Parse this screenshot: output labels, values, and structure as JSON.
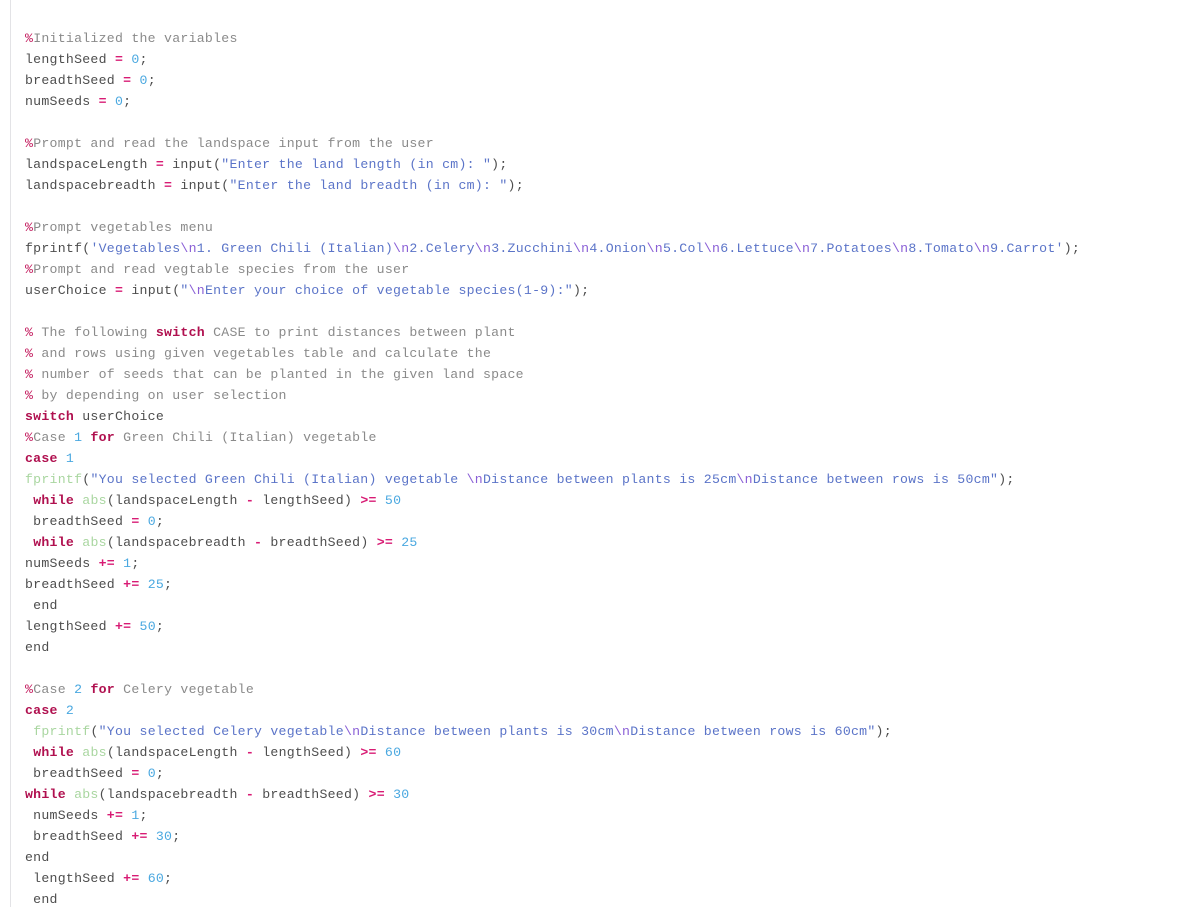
{
  "editor": {
    "language": "MATLAB",
    "background_color": "#ffffff",
    "gutter_rule_color": "#e3e3e6"
  },
  "palette": {
    "plain": "#4d4d4d",
    "comment": "#8a8a8a",
    "percent_marker": "#c2185b",
    "keyword": "#b0104f",
    "number": "#4aa8e0",
    "operator": "#d81b74",
    "string": "#5b74c8",
    "escape": "#8a5fd6",
    "function": "#a9d6a0"
  },
  "code": {
    "lines": [
      {
        "id": 1,
        "tokens": [
          {
            "t": "%",
            "c": "pct"
          },
          {
            "t": "Initialized the variables",
            "c": "comment"
          }
        ]
      },
      {
        "id": 2,
        "tokens": [
          {
            "t": "lengthSeed ",
            "c": "plain"
          },
          {
            "t": "=",
            "c": "operator"
          },
          {
            "t": " ",
            "c": "plain"
          },
          {
            "t": "0",
            "c": "number"
          },
          {
            "t": ";",
            "c": "plain"
          }
        ]
      },
      {
        "id": 3,
        "tokens": [
          {
            "t": "breadthSeed ",
            "c": "plain"
          },
          {
            "t": "=",
            "c": "operator"
          },
          {
            "t": " ",
            "c": "plain"
          },
          {
            "t": "0",
            "c": "number"
          },
          {
            "t": ";",
            "c": "plain"
          }
        ]
      },
      {
        "id": 4,
        "tokens": [
          {
            "t": "numSeeds ",
            "c": "plain"
          },
          {
            "t": "=",
            "c": "operator"
          },
          {
            "t": " ",
            "c": "plain"
          },
          {
            "t": "0",
            "c": "number"
          },
          {
            "t": ";",
            "c": "plain"
          }
        ]
      },
      {
        "id": 5,
        "tokens": []
      },
      {
        "id": 6,
        "tokens": [
          {
            "t": "%",
            "c": "pct"
          },
          {
            "t": "Prompt and read the landspace input from the user",
            "c": "comment"
          }
        ]
      },
      {
        "id": 7,
        "tokens": [
          {
            "t": "landspaceLength ",
            "c": "plain"
          },
          {
            "t": "=",
            "c": "operator"
          },
          {
            "t": " input(",
            "c": "plain"
          },
          {
            "t": "\"Enter the land length (in cm): \"",
            "c": "string"
          },
          {
            "t": ");",
            "c": "plain"
          }
        ]
      },
      {
        "id": 8,
        "tokens": [
          {
            "t": "landspacebreadth ",
            "c": "plain"
          },
          {
            "t": "=",
            "c": "operator"
          },
          {
            "t": " input(",
            "c": "plain"
          },
          {
            "t": "\"Enter the land breadth (in cm): \"",
            "c": "string"
          },
          {
            "t": ");",
            "c": "plain"
          }
        ]
      },
      {
        "id": 9,
        "tokens": []
      },
      {
        "id": 10,
        "tokens": [
          {
            "t": "%",
            "c": "pct"
          },
          {
            "t": "Prompt vegetables menu",
            "c": "comment"
          }
        ]
      },
      {
        "id": 11,
        "tokens": [
          {
            "t": "fprintf(",
            "c": "plain"
          },
          {
            "t": "'Vegetables",
            "c": "string"
          },
          {
            "t": "\\n",
            "c": "escape"
          },
          {
            "t": "1. Green Chili (Italian)",
            "c": "string"
          },
          {
            "t": "\\n",
            "c": "escape"
          },
          {
            "t": "2.Celery",
            "c": "string"
          },
          {
            "t": "\\n",
            "c": "escape"
          },
          {
            "t": "3.Zucchini",
            "c": "string"
          },
          {
            "t": "\\n",
            "c": "escape"
          },
          {
            "t": "4.Onion",
            "c": "string"
          },
          {
            "t": "\\n",
            "c": "escape"
          },
          {
            "t": "5.Col",
            "c": "string"
          },
          {
            "t": "\\n",
            "c": "escape"
          },
          {
            "t": "6.Lettuce",
            "c": "string"
          },
          {
            "t": "\\n",
            "c": "escape"
          },
          {
            "t": "7.Potatoes",
            "c": "string"
          },
          {
            "t": "\\n",
            "c": "escape"
          },
          {
            "t": "8.Tomato",
            "c": "string"
          },
          {
            "t": "\\n",
            "c": "escape"
          },
          {
            "t": "9.Carrot'",
            "c": "string"
          },
          {
            "t": ");",
            "c": "plain"
          }
        ]
      },
      {
        "id": 12,
        "tokens": [
          {
            "t": "%",
            "c": "pct"
          },
          {
            "t": "Prompt and read vegtable species from the user",
            "c": "comment"
          }
        ]
      },
      {
        "id": 13,
        "tokens": [
          {
            "t": "userChoice ",
            "c": "plain"
          },
          {
            "t": "=",
            "c": "operator"
          },
          {
            "t": " input(",
            "c": "plain"
          },
          {
            "t": "\"",
            "c": "string"
          },
          {
            "t": "\\n",
            "c": "escape"
          },
          {
            "t": "Enter your choice of vegetable species(1-9):\"",
            "c": "string"
          },
          {
            "t": ");",
            "c": "plain"
          }
        ]
      },
      {
        "id": 14,
        "tokens": []
      },
      {
        "id": 15,
        "tokens": [
          {
            "t": "%",
            "c": "pct"
          },
          {
            "t": " The following ",
            "c": "comment"
          },
          {
            "t": "switch",
            "c": "keyword"
          },
          {
            "t": " CASE to print distances between plant",
            "c": "comment"
          }
        ]
      },
      {
        "id": 16,
        "tokens": [
          {
            "t": "%",
            "c": "pct"
          },
          {
            "t": " and rows using given vegetables table and calculate the",
            "c": "comment"
          }
        ]
      },
      {
        "id": 17,
        "tokens": [
          {
            "t": "%",
            "c": "pct"
          },
          {
            "t": " number of seeds that can be planted in the given land space",
            "c": "comment"
          }
        ]
      },
      {
        "id": 18,
        "tokens": [
          {
            "t": "%",
            "c": "pct"
          },
          {
            "t": " by depending on user selection",
            "c": "comment"
          }
        ]
      },
      {
        "id": 19,
        "tokens": [
          {
            "t": "switch",
            "c": "keyword"
          },
          {
            "t": " userChoice",
            "c": "plain"
          }
        ]
      },
      {
        "id": 20,
        "tokens": [
          {
            "t": "%",
            "c": "pct"
          },
          {
            "t": "Case ",
            "c": "comment"
          },
          {
            "t": "1",
            "c": "number"
          },
          {
            "t": " ",
            "c": "comment"
          },
          {
            "t": "for",
            "c": "keyword"
          },
          {
            "t": " Green Chili (Italian) vegetable",
            "c": "comment"
          }
        ]
      },
      {
        "id": 21,
        "tokens": [
          {
            "t": "case",
            "c": "keyword"
          },
          {
            "t": " ",
            "c": "plain"
          },
          {
            "t": "1",
            "c": "number"
          }
        ]
      },
      {
        "id": 22,
        "tokens": [
          {
            "t": "fprintf",
            "c": "func"
          },
          {
            "t": "(",
            "c": "plain"
          },
          {
            "t": "\"You selected Green Chili (Italian) vegetable ",
            "c": "string"
          },
          {
            "t": "\\n",
            "c": "escape"
          },
          {
            "t": "Distance between plants is 25cm",
            "c": "string"
          },
          {
            "t": "\\n",
            "c": "escape"
          },
          {
            "t": "Distance between rows is 50cm\"",
            "c": "string"
          },
          {
            "t": ");",
            "c": "plain"
          }
        ]
      },
      {
        "id": 23,
        "tokens": [
          {
            "t": " ",
            "c": "plain"
          },
          {
            "t": "while",
            "c": "keyword"
          },
          {
            "t": " ",
            "c": "plain"
          },
          {
            "t": "abs",
            "c": "func"
          },
          {
            "t": "(landspaceLength ",
            "c": "plain"
          },
          {
            "t": "-",
            "c": "operator"
          },
          {
            "t": " lengthSeed) ",
            "c": "plain"
          },
          {
            "t": ">=",
            "c": "operator"
          },
          {
            "t": " ",
            "c": "plain"
          },
          {
            "t": "50",
            "c": "number"
          }
        ]
      },
      {
        "id": 24,
        "tokens": [
          {
            "t": " breadthSeed ",
            "c": "plain"
          },
          {
            "t": "=",
            "c": "operator"
          },
          {
            "t": " ",
            "c": "plain"
          },
          {
            "t": "0",
            "c": "number"
          },
          {
            "t": ";",
            "c": "plain"
          }
        ]
      },
      {
        "id": 25,
        "tokens": [
          {
            "t": " ",
            "c": "plain"
          },
          {
            "t": "while",
            "c": "keyword"
          },
          {
            "t": " ",
            "c": "plain"
          },
          {
            "t": "abs",
            "c": "func"
          },
          {
            "t": "(landspacebreadth ",
            "c": "plain"
          },
          {
            "t": "-",
            "c": "operator"
          },
          {
            "t": " breadthSeed) ",
            "c": "plain"
          },
          {
            "t": ">=",
            "c": "operator"
          },
          {
            "t": " ",
            "c": "plain"
          },
          {
            "t": "25",
            "c": "number"
          }
        ]
      },
      {
        "id": 26,
        "tokens": [
          {
            "t": "numSeeds ",
            "c": "plain"
          },
          {
            "t": "+=",
            "c": "operator"
          },
          {
            "t": " ",
            "c": "plain"
          },
          {
            "t": "1",
            "c": "number"
          },
          {
            "t": ";",
            "c": "plain"
          }
        ]
      },
      {
        "id": 27,
        "tokens": [
          {
            "t": "breadthSeed ",
            "c": "plain"
          },
          {
            "t": "+=",
            "c": "operator"
          },
          {
            "t": " ",
            "c": "plain"
          },
          {
            "t": "25",
            "c": "number"
          },
          {
            "t": ";",
            "c": "plain"
          }
        ]
      },
      {
        "id": 28,
        "tokens": [
          {
            "t": " end",
            "c": "plain"
          }
        ]
      },
      {
        "id": 29,
        "tokens": [
          {
            "t": "lengthSeed ",
            "c": "plain"
          },
          {
            "t": "+=",
            "c": "operator"
          },
          {
            "t": " ",
            "c": "plain"
          },
          {
            "t": "50",
            "c": "number"
          },
          {
            "t": ";",
            "c": "plain"
          }
        ]
      },
      {
        "id": 30,
        "tokens": [
          {
            "t": "end",
            "c": "plain"
          }
        ]
      },
      {
        "id": 31,
        "tokens": []
      },
      {
        "id": 32,
        "tokens": [
          {
            "t": "%",
            "c": "pct"
          },
          {
            "t": "Case ",
            "c": "comment"
          },
          {
            "t": "2",
            "c": "number"
          },
          {
            "t": " ",
            "c": "comment"
          },
          {
            "t": "for",
            "c": "keyword"
          },
          {
            "t": " Celery vegetable",
            "c": "comment"
          }
        ]
      },
      {
        "id": 33,
        "tokens": [
          {
            "t": "case",
            "c": "keyword"
          },
          {
            "t": " ",
            "c": "plain"
          },
          {
            "t": "2",
            "c": "number"
          }
        ]
      },
      {
        "id": 34,
        "tokens": [
          {
            "t": " ",
            "c": "plain"
          },
          {
            "t": "fprintf",
            "c": "func"
          },
          {
            "t": "(",
            "c": "plain"
          },
          {
            "t": "\"You selected Celery vegetable",
            "c": "string"
          },
          {
            "t": "\\n",
            "c": "escape"
          },
          {
            "t": "Distance between plants is 30cm",
            "c": "string"
          },
          {
            "t": "\\n",
            "c": "escape"
          },
          {
            "t": "Distance between rows is 60cm\"",
            "c": "string"
          },
          {
            "t": ");",
            "c": "plain"
          }
        ]
      },
      {
        "id": 35,
        "tokens": [
          {
            "t": " ",
            "c": "plain"
          },
          {
            "t": "while",
            "c": "keyword"
          },
          {
            "t": " ",
            "c": "plain"
          },
          {
            "t": "abs",
            "c": "func"
          },
          {
            "t": "(landspaceLength ",
            "c": "plain"
          },
          {
            "t": "-",
            "c": "operator"
          },
          {
            "t": " lengthSeed) ",
            "c": "plain"
          },
          {
            "t": ">=",
            "c": "operator"
          },
          {
            "t": " ",
            "c": "plain"
          },
          {
            "t": "60",
            "c": "number"
          }
        ]
      },
      {
        "id": 36,
        "tokens": [
          {
            "t": " breadthSeed ",
            "c": "plain"
          },
          {
            "t": "=",
            "c": "operator"
          },
          {
            "t": " ",
            "c": "plain"
          },
          {
            "t": "0",
            "c": "number"
          },
          {
            "t": ";",
            "c": "plain"
          }
        ]
      },
      {
        "id": 37,
        "tokens": [
          {
            "t": "while",
            "c": "keyword"
          },
          {
            "t": " ",
            "c": "plain"
          },
          {
            "t": "abs",
            "c": "func"
          },
          {
            "t": "(landspacebreadth ",
            "c": "plain"
          },
          {
            "t": "-",
            "c": "operator"
          },
          {
            "t": " breadthSeed) ",
            "c": "plain"
          },
          {
            "t": ">=",
            "c": "operator"
          },
          {
            "t": " ",
            "c": "plain"
          },
          {
            "t": "30",
            "c": "number"
          }
        ]
      },
      {
        "id": 38,
        "tokens": [
          {
            "t": " numSeeds ",
            "c": "plain"
          },
          {
            "t": "+=",
            "c": "operator"
          },
          {
            "t": " ",
            "c": "plain"
          },
          {
            "t": "1",
            "c": "number"
          },
          {
            "t": ";",
            "c": "plain"
          }
        ]
      },
      {
        "id": 39,
        "tokens": [
          {
            "t": " breadthSeed ",
            "c": "plain"
          },
          {
            "t": "+=",
            "c": "operator"
          },
          {
            "t": " ",
            "c": "plain"
          },
          {
            "t": "30",
            "c": "number"
          },
          {
            "t": ";",
            "c": "plain"
          }
        ]
      },
      {
        "id": 40,
        "tokens": [
          {
            "t": "end",
            "c": "plain"
          }
        ]
      },
      {
        "id": 41,
        "tokens": [
          {
            "t": " lengthSeed ",
            "c": "plain"
          },
          {
            "t": "+=",
            "c": "operator"
          },
          {
            "t": " ",
            "c": "plain"
          },
          {
            "t": "60",
            "c": "number"
          },
          {
            "t": ";",
            "c": "plain"
          }
        ]
      },
      {
        "id": 42,
        "tokens": [
          {
            "t": " end",
            "c": "plain"
          }
        ]
      }
    ]
  }
}
